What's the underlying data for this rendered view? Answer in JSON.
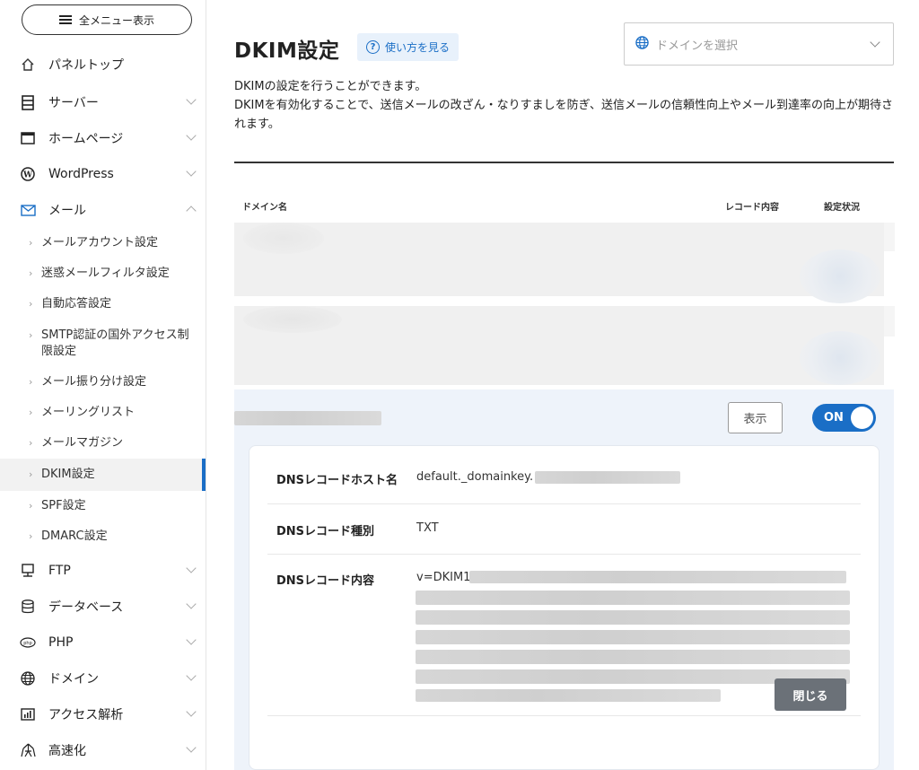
{
  "sidebar": {
    "menu_button": "全メニュー表示",
    "items": [
      {
        "label": "パネルトップ",
        "icon": "home-icon"
      },
      {
        "label": "サーバー",
        "icon": "server-icon"
      },
      {
        "label": "ホームページ",
        "icon": "browser-icon"
      },
      {
        "label": "WordPress",
        "icon": "wordpress-icon"
      },
      {
        "label": "メール",
        "icon": "mail-icon"
      },
      {
        "label": "FTP",
        "icon": "monitor-icon"
      },
      {
        "label": "データベース",
        "icon": "database-icon"
      },
      {
        "label": "PHP",
        "icon": "php-icon"
      },
      {
        "label": "ドメイン",
        "icon": "globe-icon"
      },
      {
        "label": "アクセス解析",
        "icon": "chart-icon"
      },
      {
        "label": "高速化",
        "icon": "speed-icon"
      }
    ],
    "mail_sub": [
      "メールアカウント設定",
      "迷惑メールフィルタ設定",
      "自動応答設定",
      "SMTP認証の国外アクセス制限設定",
      "メール振り分け設定",
      "メーリングリスト",
      "メールマガジン",
      "DKIM設定",
      "SPF設定",
      "DMARC設定"
    ]
  },
  "header": {
    "title": "DKIM設定",
    "howto_label": "使い方を見る",
    "domain_placeholder": "ドメインを選択"
  },
  "description": {
    "line1": "DKIMの設定を行うことができます。",
    "line2": "DKIMを有効化することで、送信メールの改ざん・なりすましを防ぎ、送信メールの信頼性向上やメール到達率の向上が期待されます。"
  },
  "table": {
    "headers": [
      "ドメイン名",
      "レコード内容",
      "設定状況"
    ]
  },
  "expanded": {
    "show_button": "表示",
    "toggle_label": "ON",
    "toggle_on": true,
    "fields": [
      {
        "label": "DNSレコードホスト名",
        "value": "default._domainkey."
      },
      {
        "label": "DNSレコード種別",
        "value": "TXT"
      },
      {
        "label": "DNSレコード内容",
        "value": "v=DKIM1"
      }
    ],
    "close_button": "閉じる"
  },
  "colors": {
    "accent": "#1a6ec6",
    "close_button": "#6b7178",
    "expanded_bg": "#eef3fa"
  }
}
